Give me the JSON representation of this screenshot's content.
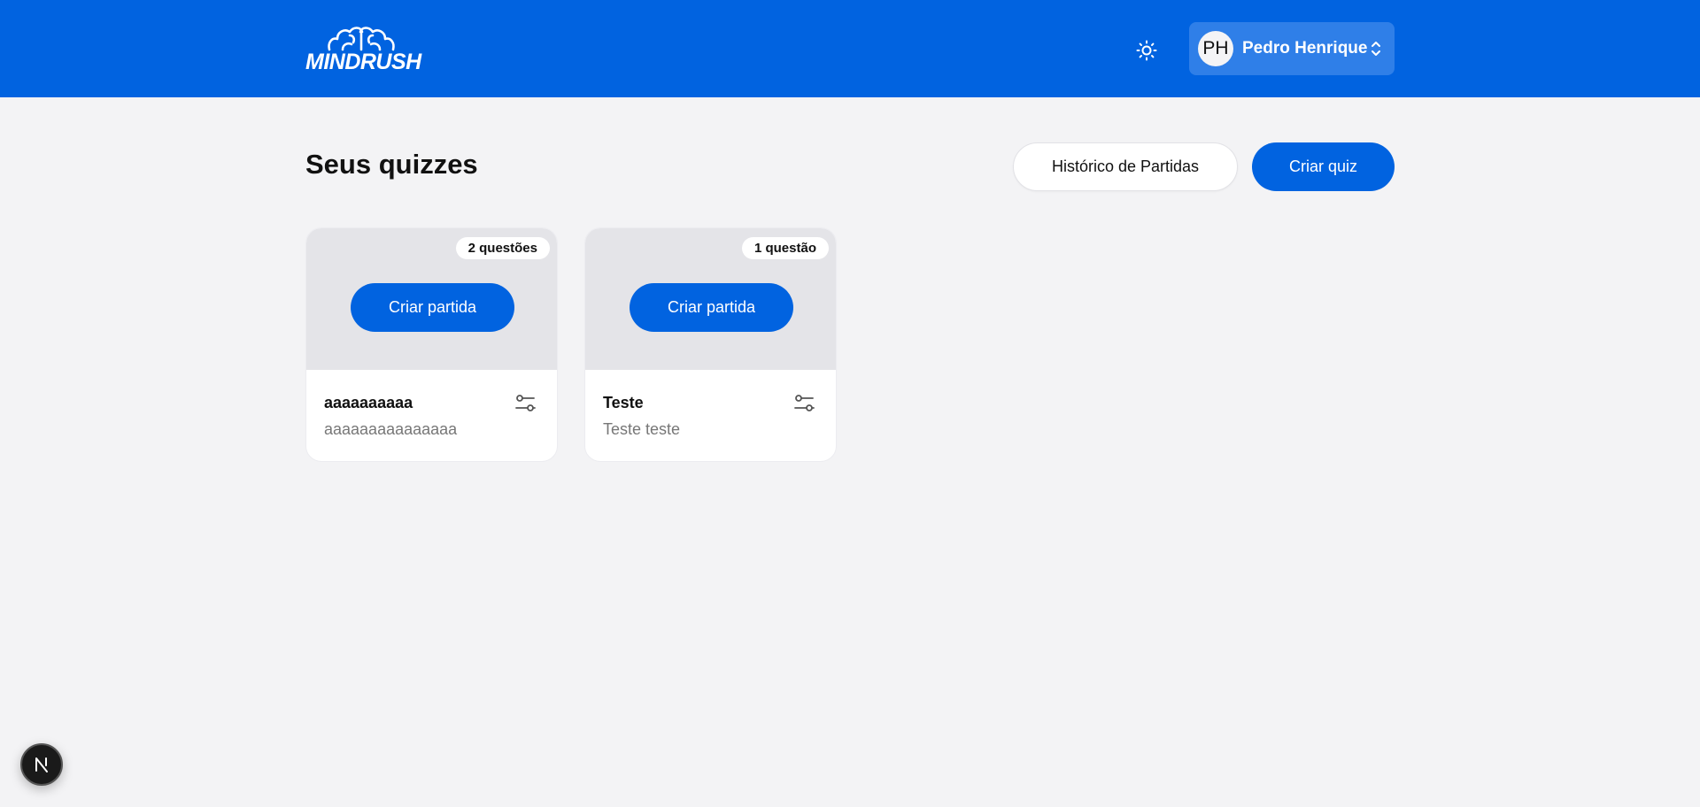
{
  "app": {
    "brand_name": "MINDRUSH",
    "brand_color": "#0163e0"
  },
  "header": {
    "theme_icon": "sun-icon",
    "user": {
      "initials": "PH",
      "name": "Pedro Henrique",
      "chevron_icon": "chevron-up-down-icon"
    }
  },
  "main": {
    "title": "Seus quizzes",
    "history_button": "Histórico de Partidas",
    "create_quiz_button": "Criar quiz",
    "quizzes": [
      {
        "question_count": "2 questões",
        "create_match_label": "Criar partida",
        "title": "aaaaaaaaaa",
        "description": "aaaaaaaaaaaaaaa",
        "settings_icon": "sliders-icon"
      },
      {
        "question_count": "1 questão",
        "create_match_label": "Criar partida",
        "title": "Teste",
        "description": "Teste teste",
        "settings_icon": "sliders-icon"
      }
    ]
  },
  "devtools": {
    "label": "N"
  }
}
